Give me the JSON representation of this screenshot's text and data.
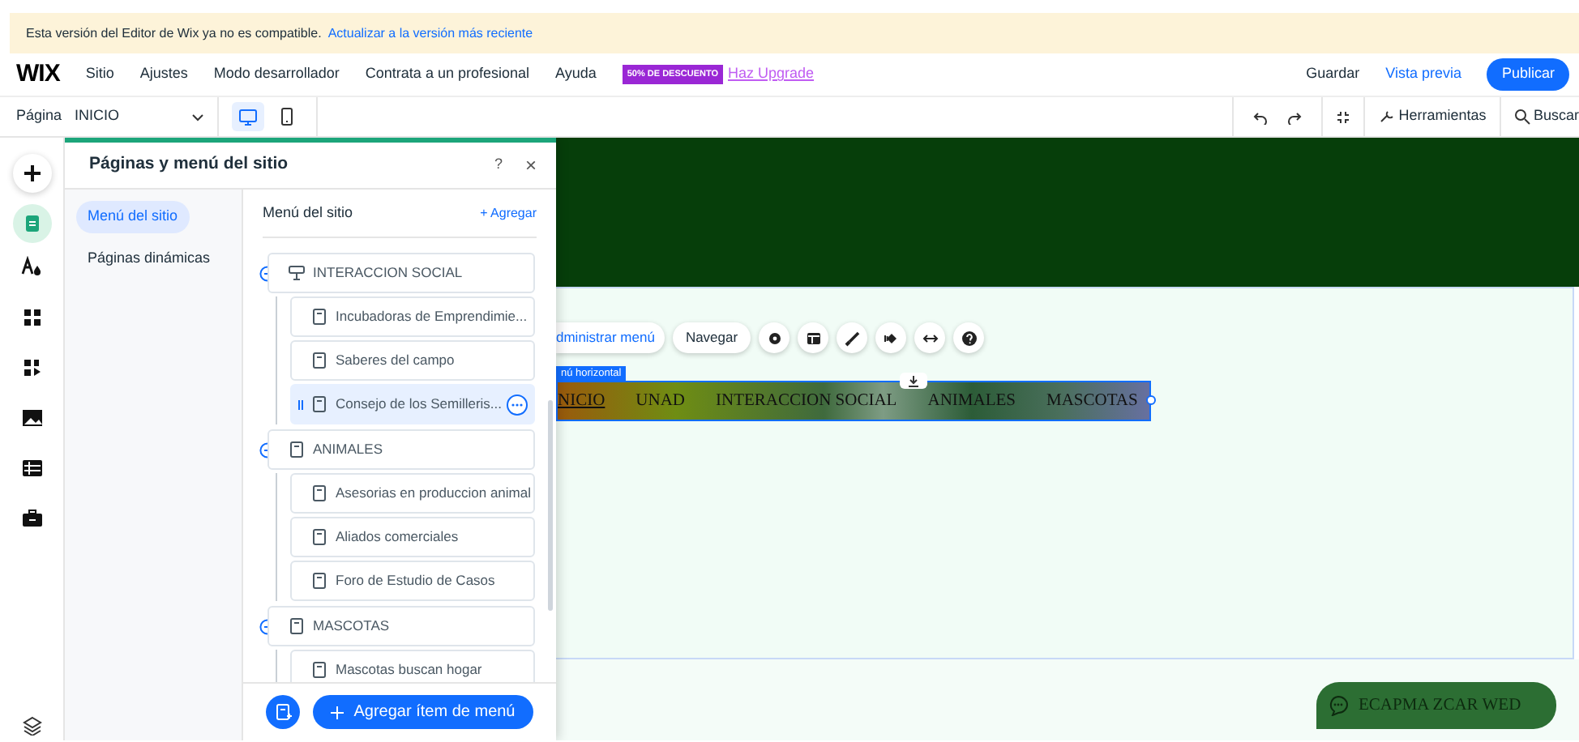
{
  "banner": {
    "message": "Esta versión del Editor de Wix ya no es compatible.",
    "link": "Actualizar a la versión más reciente"
  },
  "topbar": {
    "logo": "WIX",
    "menu": [
      "Sitio",
      "Ajustes",
      "Modo desarrollador",
      "Contrata a un profesional",
      "Ayuda"
    ],
    "promo_badge": "50% DE DESCUENTO",
    "upgrade": "Haz Upgrade",
    "save": "Guardar",
    "preview": "Vista previa",
    "publish": "Publicar"
  },
  "toolbar": {
    "page_label": "Página",
    "page": "INICIO",
    "devices": [
      {
        "kind": "desktop",
        "selected": true
      },
      {
        "kind": "mobile",
        "selected": false
      }
    ],
    "tools": "Herramientas",
    "search": "Buscar"
  },
  "left_rail": [
    {
      "kind": "add",
      "selected": false
    },
    {
      "kind": "pages",
      "selected": true
    },
    {
      "kind": "theme",
      "selected": false
    },
    {
      "kind": "apps",
      "selected": false
    },
    {
      "kind": "market",
      "selected": false
    },
    {
      "kind": "media",
      "selected": false
    },
    {
      "kind": "table",
      "selected": false
    },
    {
      "kind": "portfolio",
      "selected": false
    }
  ],
  "panel": {
    "title": "Páginas y menú del sitio",
    "help": "?",
    "close": "×",
    "nav": [
      {
        "label": "Menú del sitio",
        "selected": true
      },
      {
        "label": "Páginas dinámicas",
        "selected": false
      }
    ],
    "section_title": "Menú del sitio",
    "add_link": "+ Agregar",
    "items": [
      {
        "label": "INTERACCION SOCIAL",
        "kind": "dropdown",
        "expanded": true,
        "selected": false,
        "children": [
          {
            "label": "Incubadoras de Emprendimie...",
            "selected": false
          },
          {
            "label": "Saberes del campo",
            "selected": false
          },
          {
            "label": "Consejo de los Semilleris...",
            "selected": true
          }
        ]
      },
      {
        "label": "ANIMALES",
        "kind": "page",
        "expanded": true,
        "selected": false,
        "children": [
          {
            "label": "Asesorias en produccion animal",
            "selected": false
          },
          {
            "label": "Aliados comerciales",
            "selected": false
          },
          {
            "label": "Foro de Estudio de Casos",
            "selected": false
          }
        ]
      },
      {
        "label": "MASCOTAS",
        "kind": "page",
        "expanded": true,
        "selected": false,
        "children": [
          {
            "label": "Mascotas buscan hogar",
            "selected": false
          }
        ]
      }
    ],
    "add_item_button": "Agregar ítem de menú"
  },
  "canvas": {
    "menu_buttons": [
      {
        "label": "dministrar menú",
        "kind": "primary"
      },
      {
        "label": "Navegar",
        "kind": "plain"
      }
    ],
    "menu_tag": "nú horizontal",
    "menu": [
      {
        "label": "NICIO",
        "selected": true
      },
      {
        "label": "UNAD",
        "selected": false
      },
      {
        "label": "INTERACCION SOCIAL",
        "selected": false
      },
      {
        "label": "ANIMALES",
        "selected": false
      },
      {
        "label": "MASCOTAS",
        "selected": false
      }
    ],
    "chat_button": "ECAPMA ZCAR WED"
  }
}
